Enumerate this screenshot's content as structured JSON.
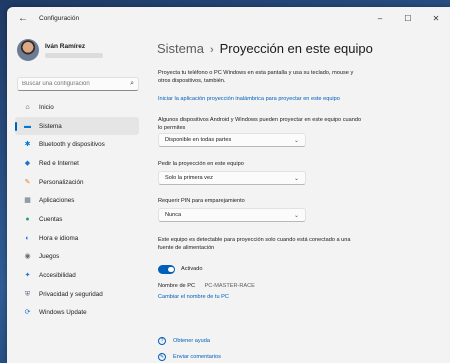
{
  "window": {
    "app_title": "Configuración",
    "back_glyph": "←",
    "minimize_glyph": "–",
    "maximize_glyph": "☐",
    "close_glyph": "✕"
  },
  "profile": {
    "name": "Iván Ramírez"
  },
  "search": {
    "placeholder": "Buscar una configuración",
    "icon": "search-icon"
  },
  "sidebar": {
    "active_color": "#005fb8",
    "items": [
      {
        "label": "Inicio",
        "icon": "home-icon",
        "glyph": "⌂",
        "color": "#444444"
      },
      {
        "label": "Sistema",
        "icon": "system-icon",
        "glyph": "▬",
        "color": "#0078d4",
        "active": true
      },
      {
        "label": "Bluetooth y dispositivos",
        "icon": "bluetooth-icon",
        "glyph": "✱",
        "color": "#0078d4"
      },
      {
        "label": "Red e Internet",
        "icon": "network-icon",
        "glyph": "◆",
        "color": "#1f6fd1"
      },
      {
        "label": "Personalización",
        "icon": "personalization-icon",
        "glyph": "✎",
        "color": "#e8812c"
      },
      {
        "label": "Aplicaciones",
        "icon": "apps-icon",
        "glyph": "▦",
        "color": "#5c6b80"
      },
      {
        "label": "Cuentas",
        "icon": "accounts-icon",
        "glyph": "●",
        "color": "#2aa36b"
      },
      {
        "label": "Hora e idioma",
        "icon": "time-language-icon",
        "glyph": "◐",
        "color": "#1f6fd1"
      },
      {
        "label": "Juegos",
        "icon": "gaming-icon",
        "glyph": "◉",
        "color": "#6b6b6b"
      },
      {
        "label": "Accesibilidad",
        "icon": "accessibility-icon",
        "glyph": "✦",
        "color": "#1f6fd1"
      },
      {
        "label": "Privacidad y seguridad",
        "icon": "privacy-shield-icon",
        "glyph": "⛨",
        "color": "#5c6b80"
      },
      {
        "label": "Windows Update",
        "icon": "windows-update-icon",
        "glyph": "⟳",
        "color": "#1f6fd1"
      }
    ]
  },
  "header": {
    "parent": "Sistema",
    "separator": "›",
    "title": "Proyección en este equipo"
  },
  "main": {
    "intro": "Proyecta tu teléfono o PC Windows en esta pantalla y usa su teclado, mouse y otros dispositivos, también.",
    "wireless_link": "Iniciar la aplicación proyección inalámbrica para proyectar en este equipo",
    "setting1_label": "Algunos dispositivos Android y Windows pueden proyectar en este equipo cuando lo permites",
    "setting1_value": "Disponible en todas partes",
    "setting2_label": "Pedir la proyección en este equipo",
    "setting2_value": "Solo la primera vez",
    "setting3_label": "Requerir PIN para emparejamiento",
    "setting3_value": "Nunca",
    "power_note": "Este equipo es detectable para proyección solo cuando está conectado a una fuente de alimentación",
    "toggle_label": "Activado",
    "toggle_on": true,
    "pc_name_label": "Nombre de PC",
    "pc_name_value": "PC-MASTER-RACE",
    "rename_link": "Cambiar el nombre de tu PC",
    "help_link": "Obtener ayuda",
    "feedback_link": "Enviar comentarios",
    "chevron": "⌄"
  }
}
